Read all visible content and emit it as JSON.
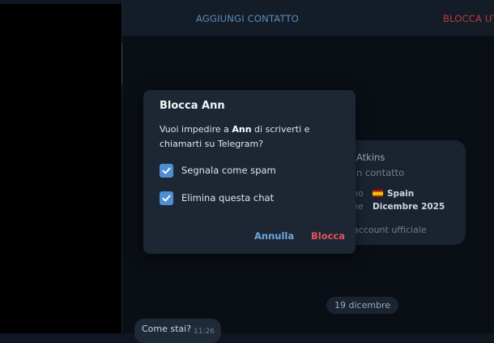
{
  "header": {
    "add_contact_label": "AGGIUNGI CONTATTO",
    "block_user_label": "BLOCCA UTE"
  },
  "dialog": {
    "title": "Blocca Ann",
    "message_before": "Vuoi impedire a ",
    "message_name": "Ann",
    "message_after": " di scriverti e chiamarti su Telegram?",
    "checkbox_spam_label": "Segnala come spam",
    "checkbox_spam_checked": true,
    "checkbox_delete_label": "Elimina questa chat",
    "checkbox_delete_checked": true,
    "cancel_label": "Annulla",
    "block_label": "Blocca"
  },
  "info_card": {
    "name_fragment": "Atkins",
    "subtitle_fragment": "n contatto",
    "row1_label_fragment": "ono",
    "row1_flag_icon": "spain-flag-icon",
    "row1_value": "Spain",
    "row2_label_fragment": "one",
    "row2_value": "Dicembre 2025",
    "footer_fragment": "account ufficiale"
  },
  "chat": {
    "date_label": "19 dicembre",
    "message_text": "Come stai?",
    "message_time": "11:26"
  },
  "colors": {
    "background": "#0e1621",
    "accent_blue": "#4e8fd4",
    "danger_red": "#e5535b"
  }
}
